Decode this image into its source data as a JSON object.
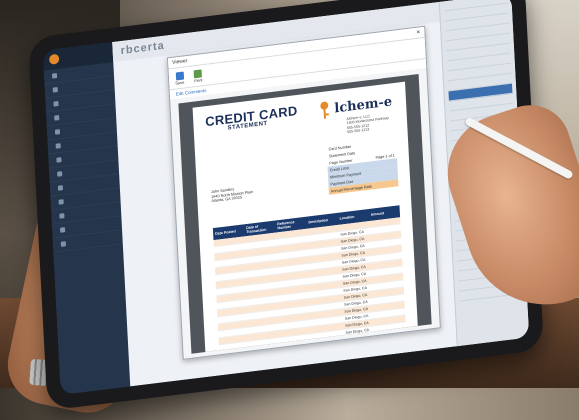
{
  "app": {
    "brand": "rbcerta",
    "sidebar_items": [
      "",
      "",
      "",
      "",
      "",
      "",
      "",
      "",
      "",
      "",
      "",
      "",
      ""
    ]
  },
  "viewer": {
    "window_title": "Viewer",
    "tool_save": "Save",
    "tool_print": "Print",
    "sub_link": "Edit Comments"
  },
  "statement": {
    "title": "CREDIT CARD",
    "subtitle": "STATEMENT",
    "logo_text": "lchem-e",
    "company_lines": [
      "Alchem-e, LLC",
      "1500 Montezuma Parkway",
      "555-555-1212",
      "555-555-1213"
    ],
    "info_rows": [
      {
        "label": "Card Number",
        "value": "",
        "style": "plain"
      },
      {
        "label": "Statement Date",
        "value": "",
        "style": "plain"
      },
      {
        "label": "Page Number",
        "value": "Page 1 of 1",
        "style": "plain"
      },
      {
        "label": "Credit Limit",
        "value": "",
        "style": "blue"
      },
      {
        "label": "Minimum Payment",
        "value": "",
        "style": "blue"
      },
      {
        "label": "Payment Due",
        "value": "",
        "style": "blue"
      },
      {
        "label": "Annual Percentage Rate",
        "value": "",
        "style": "orange"
      }
    ],
    "customer_lines": [
      "John Sanders",
      "1940 North Mission Plain",
      "Atlanta, GA 30325"
    ],
    "table": {
      "headers": [
        "Date Posted",
        "Date of Transaction",
        "Reference Number",
        "Description",
        "Location",
        "Amount"
      ],
      "rows": [
        [
          "",
          "",
          "",
          "",
          "",
          ""
        ],
        [
          "",
          "",
          "",
          "",
          "San Diego, CA",
          ""
        ],
        [
          "",
          "",
          "",
          "",
          "San Diego, CA",
          ""
        ],
        [
          "",
          "",
          "",
          "",
          "San Diego, CA",
          ""
        ],
        [
          "",
          "",
          "",
          "",
          "San Diego, CA",
          ""
        ],
        [
          "",
          "",
          "",
          "",
          "San Diego, CA",
          ""
        ],
        [
          "",
          "",
          "",
          "",
          "San Diego, CA",
          ""
        ],
        [
          "",
          "",
          "",
          "",
          "San Diego, CA",
          ""
        ],
        [
          "",
          "",
          "",
          "",
          "San Diego, CA",
          ""
        ],
        [
          "",
          "",
          "",
          "",
          "San Diego, CA",
          ""
        ],
        [
          "",
          "",
          "",
          "",
          "San Diego, CA",
          ""
        ],
        [
          "",
          "",
          "",
          "",
          "San Diego, CA",
          ""
        ],
        [
          "",
          "",
          "",
          "",
          "San Diego, CA",
          ""
        ],
        [
          "",
          "",
          "",
          "",
          "San Diego, CA",
          ""
        ],
        [
          "",
          "",
          "",
          "",
          "San Diego, CA",
          ""
        ],
        [
          "",
          "",
          "",
          "",
          "San Diego, CA",
          ""
        ],
        [
          "",
          "",
          "",
          "",
          "San Diego, CA",
          ""
        ],
        [
          "",
          "",
          "",
          "",
          "San Diego, CA",
          ""
        ]
      ]
    }
  },
  "colors": {
    "navy": "#1b2f5a",
    "orange": "#e58a2a",
    "row_tint": "#fbe7d3"
  }
}
